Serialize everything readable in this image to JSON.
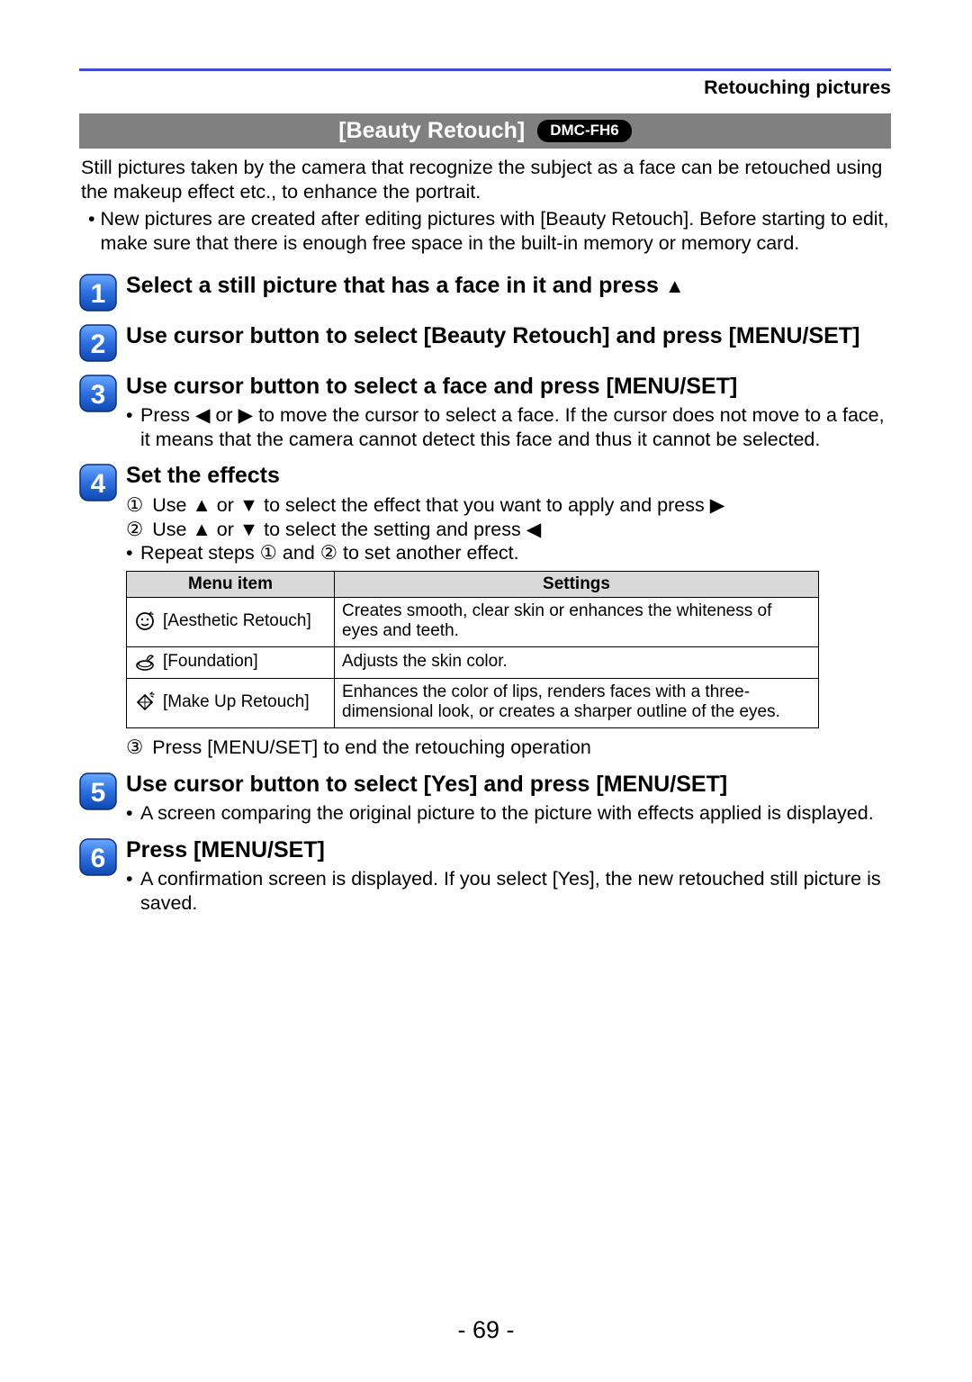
{
  "header": {
    "section": "Retouching pictures",
    "title": "[Beauty Retouch]",
    "model": "DMC-FH6"
  },
  "intro": {
    "p1": "Still pictures taken by the camera that recognize the subject as a face can be retouched using the makeup effect etc., to enhance the portrait.",
    "b1": "New pictures are created after editing pictures with [Beauty Retouch]. Before starting to edit, make sure that there is enough free space in the built-in memory or memory card."
  },
  "steps": {
    "s1": {
      "num": "1",
      "title_a": "Select a still picture that has a face in it and press "
    },
    "s2": {
      "num": "2",
      "title": "Use cursor button to select [Beauty Retouch] and press [MENU/SET]"
    },
    "s3": {
      "num": "3",
      "title": "Use cursor button to select a face and press [MENU/SET]",
      "b1a": "Press ",
      "b1b": " or ",
      "b1c": " to move the cursor to select a face. If the cursor does not move to a face, it means that the camera cannot detect this face and thus it cannot be selected."
    },
    "s4": {
      "num": "4",
      "title": "Set the effects",
      "l1a": "Use ",
      "l1b": " or ",
      "l1c": " to select the effect that you want to apply and press ",
      "l2a": "Use ",
      "l2b": " or ",
      "l2c": " to select the setting and press ",
      "rep": "Repeat steps ① and ② to set another effect.",
      "tbl": {
        "h1": "Menu item",
        "h2": "Settings",
        "r1": {
          "name": "[Aesthetic Retouch]",
          "desc": "Creates smooth, clear skin or enhances the whiteness of eyes and teeth."
        },
        "r2": {
          "name": "[Foundation]",
          "desc": "Adjusts the skin color."
        },
        "r3": {
          "name": "[Make Up Retouch]",
          "desc": "Enhances the color of lips, renders faces with a three-dimensional look, or creates a sharper outline of the eyes."
        }
      },
      "end": "Press [MENU/SET] to end the retouching operation"
    },
    "s5": {
      "num": "5",
      "title": "Use cursor button to select [Yes] and press [MENU/SET]",
      "b1": "A screen comparing the original picture to the picture with effects applied is displayed."
    },
    "s6": {
      "num": "6",
      "title": "Press [MENU/SET]",
      "b1": "A confirmation screen is displayed. If you select [Yes], the new retouched still picture is saved."
    }
  },
  "pgnum": "- 69 -",
  "marks": {
    "c1": "①",
    "c2": "②",
    "c3": "③",
    "dot": "•"
  }
}
